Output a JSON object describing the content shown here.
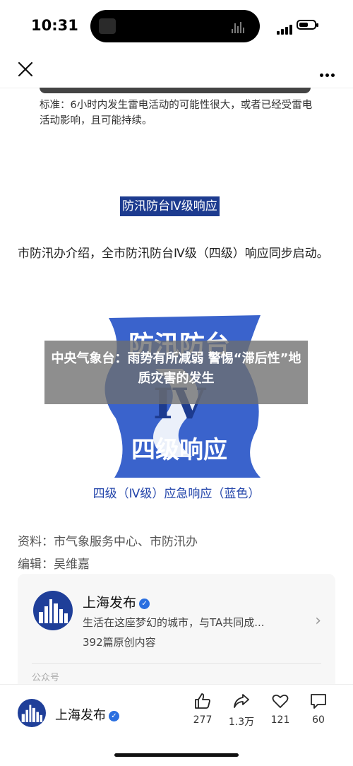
{
  "status_bar": {
    "time": "10:31"
  },
  "article": {
    "standard_note": "标准：6小时内发生雷电活动的可能性很大，或者已经受雷电活动影响，且可能持续。",
    "section_heading": "防汛防台Ⅳ级响应",
    "paragraph": "市防汛办介绍，全市防汛防台Ⅳ级（四级）响应同步启动。",
    "logo_text_top": "防汛防台",
    "logo_numeral": "IV",
    "logo_text_bottom": "四级响应",
    "caption": "四级（Ⅳ级）应急响应（蓝色）",
    "source_credit": "资料：市气象服务中心、市防汛办",
    "editor_credit": "编辑：吴维嘉"
  },
  "account_card": {
    "name": "上海发布",
    "description": "生活在这座梦幻的城市，与TA共同成...",
    "article_count": "392篇原创内容",
    "section_label": "公众号"
  },
  "overlay": {
    "headline": "中央气象台：雨势有所减弱 警惕“滞后性”地质灾害的发生"
  },
  "bottom_bar": {
    "account_name": "上海发布",
    "likes": "277",
    "shares": "1.3万",
    "favorites": "121",
    "comments": "60"
  },
  "colors": {
    "heading_bg": "#1d3b8f",
    "logo_blue": "#3a63cc",
    "caption_blue": "#2244aa",
    "verify_blue": "#2a6fe0"
  },
  "icons": [
    "close-icon",
    "more-icon",
    "verified-icon",
    "chevron-right-icon",
    "like-icon",
    "share-icon",
    "favorite-icon",
    "comment-icon"
  ]
}
